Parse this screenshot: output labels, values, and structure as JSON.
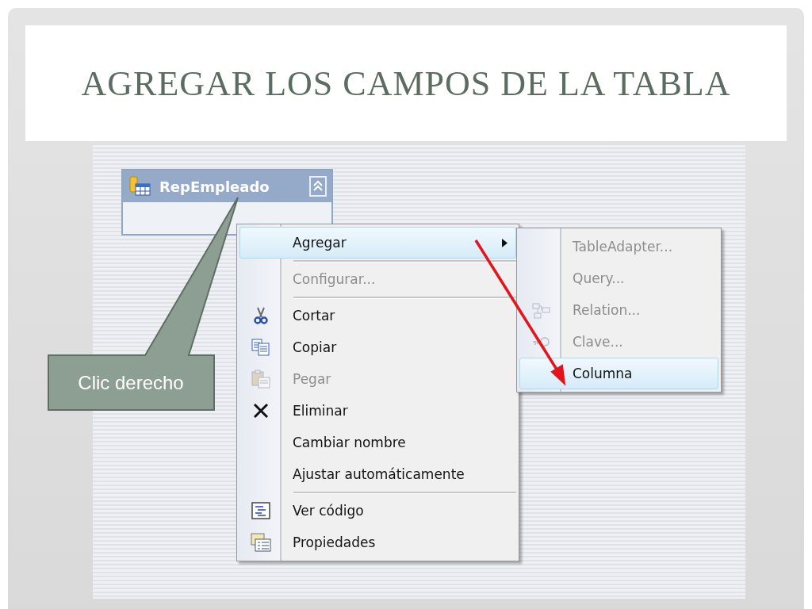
{
  "slide": {
    "title": "AGREGAR LOS CAMPOS DE LA TABLA"
  },
  "table": {
    "name": "RepEmpleado"
  },
  "context_menu": {
    "items": [
      {
        "kind": "submenu",
        "label": "Agregar",
        "disabled": false,
        "selected": true
      },
      {
        "kind": "separator"
      },
      {
        "kind": "item",
        "label": "Configurar...",
        "disabled": true,
        "selected": false
      },
      {
        "kind": "separator"
      },
      {
        "kind": "item",
        "label": "Cortar",
        "disabled": false,
        "selected": false
      },
      {
        "kind": "item",
        "label": "Copiar",
        "disabled": false,
        "selected": false
      },
      {
        "kind": "item",
        "label": "Pegar",
        "disabled": true,
        "selected": false
      },
      {
        "kind": "item",
        "label": "Eliminar",
        "disabled": false,
        "selected": false
      },
      {
        "kind": "item",
        "label": "Cambiar nombre",
        "disabled": false,
        "selected": false
      },
      {
        "kind": "item",
        "label": "Ajustar automáticamente",
        "disabled": false,
        "selected": false
      },
      {
        "kind": "separator"
      },
      {
        "kind": "item",
        "label": "Ver código",
        "disabled": false,
        "selected": false
      },
      {
        "kind": "item",
        "label": "Propiedades",
        "disabled": false,
        "selected": false
      }
    ]
  },
  "submenu": {
    "items": [
      {
        "kind": "item",
        "label": "TableAdapter...",
        "disabled": true,
        "selected": false
      },
      {
        "kind": "item",
        "label": "Query...",
        "disabled": true,
        "selected": false
      },
      {
        "kind": "item",
        "label": "Relation...",
        "disabled": true,
        "selected": false
      },
      {
        "kind": "item",
        "label": "Clave...",
        "disabled": true,
        "selected": false
      },
      {
        "kind": "item",
        "label": "Columna",
        "disabled": false,
        "selected": true
      }
    ]
  },
  "callout": {
    "text": "Clic derecho"
  }
}
